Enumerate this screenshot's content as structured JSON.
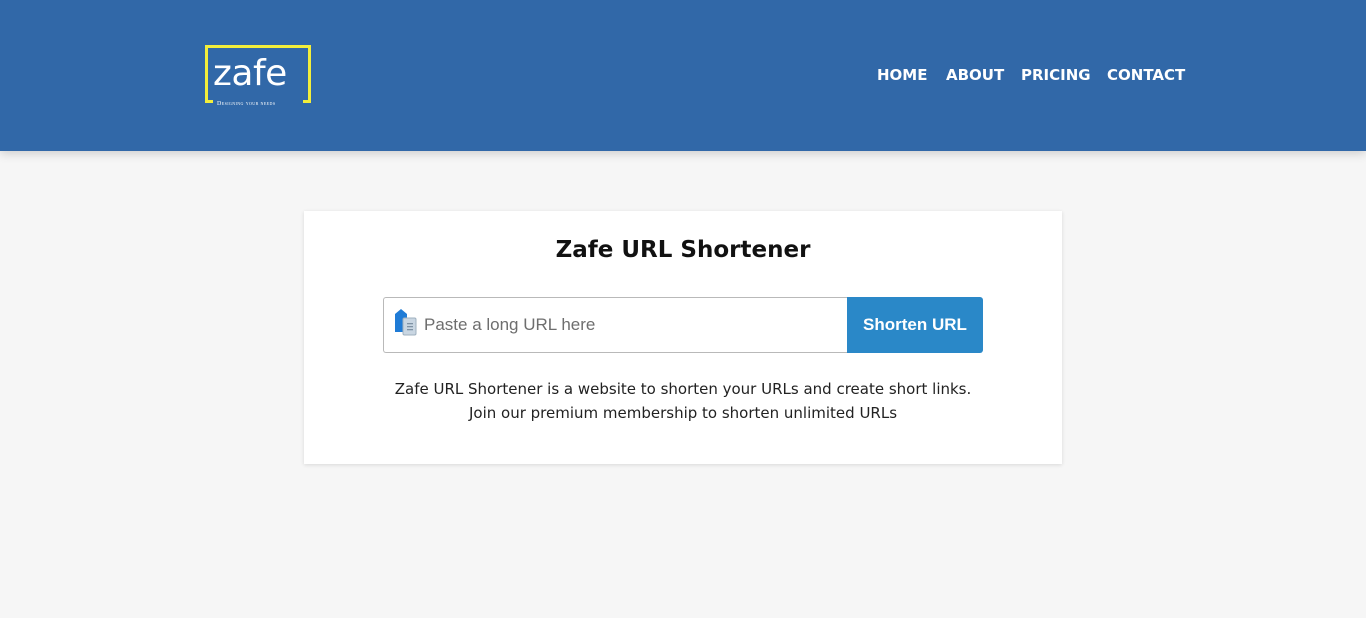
{
  "header": {
    "logo": {
      "word": "zafe",
      "tagline": "Designing your needs",
      "accent": "#f2ee3c"
    },
    "nav": [
      {
        "label": "HOME"
      },
      {
        "label": "ABOUT"
      },
      {
        "label": "PRICING"
      },
      {
        "label": "CONTACT"
      }
    ],
    "background": "#3168a8"
  },
  "card": {
    "title": "Zafe URL Shortener",
    "input": {
      "placeholder": "Paste a long URL here",
      "value": "",
      "icon": "clipboard-icon"
    },
    "button_label": "Shorten URL",
    "description": [
      "Zafe URL Shortener is a website to shorten your URLs and create short links.",
      "Join our premium membership to shorten unlimited URLs"
    ],
    "button_color": "#2a88c8"
  }
}
